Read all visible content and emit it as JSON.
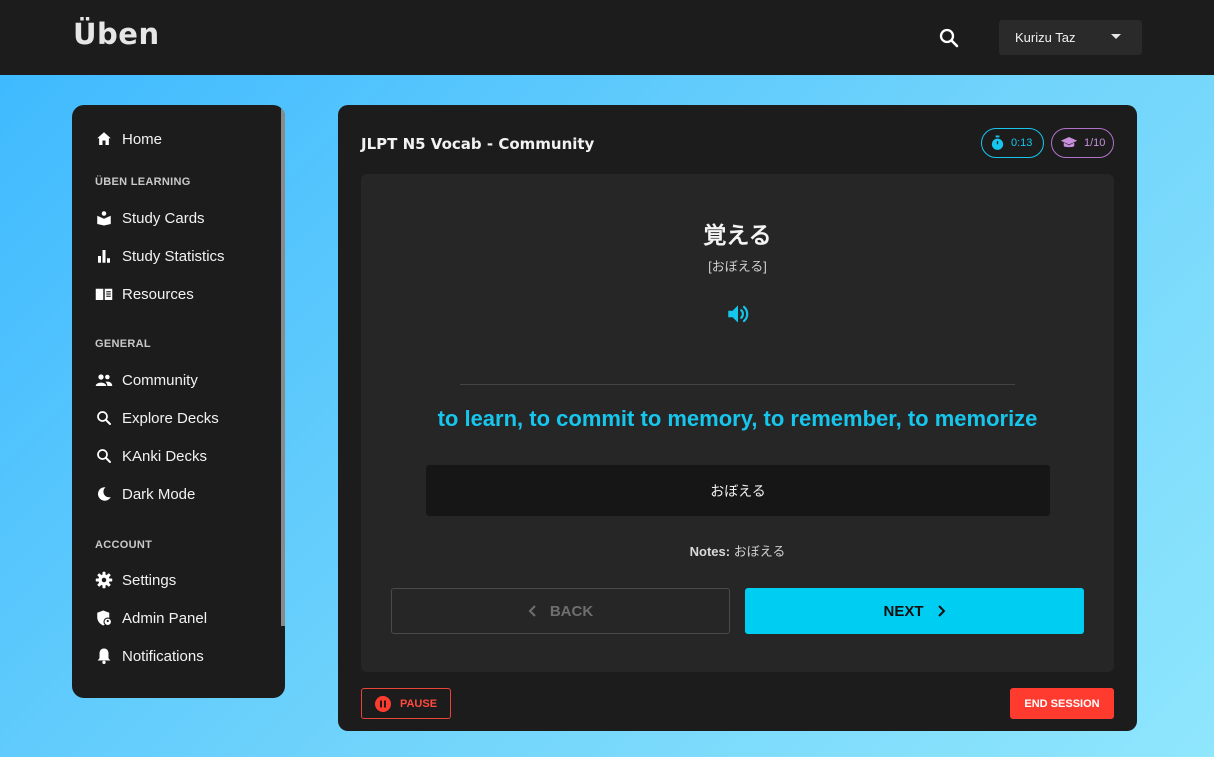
{
  "header": {
    "brand": "Üben",
    "search_icon": "search-icon",
    "user_name": "Kurizu Taz"
  },
  "sidebar": {
    "items_top": [
      {
        "label": "Home",
        "icon": "home-icon"
      }
    ],
    "sections": [
      {
        "heading": "ÜBEN LEARNING",
        "items": [
          {
            "label": "Study Cards",
            "icon": "book-open-icon"
          },
          {
            "label": "Study Statistics",
            "icon": "bar-chart-icon"
          },
          {
            "label": "Resources",
            "icon": "menu-book-icon"
          }
        ]
      },
      {
        "heading": "GENERAL",
        "items": [
          {
            "label": "Community",
            "icon": "people-icon"
          },
          {
            "label": "Explore Decks",
            "icon": "search-icon"
          },
          {
            "label": "KAnki Decks",
            "icon": "search-icon"
          },
          {
            "label": "Dark Mode",
            "icon": "moon-icon"
          }
        ]
      },
      {
        "heading": "ACCOUNT",
        "items": [
          {
            "label": "Settings",
            "icon": "gear-icon"
          },
          {
            "label": "Admin Panel",
            "icon": "admin-shield-icon"
          },
          {
            "label": "Notifications",
            "icon": "bell-icon"
          }
        ]
      }
    ]
  },
  "session": {
    "deck_title": "JLPT N5 Vocab - Community",
    "timer": "0:13",
    "progress": "1/10",
    "card": {
      "word": "覚える",
      "reading": "[おぼえる]",
      "meaning": "to learn, to commit to memory, to remember, to memorize",
      "answer_value": "おぼえる",
      "notes_label": "Notes:",
      "notes_value": "おぼえる"
    },
    "back_label": "BACK",
    "next_label": "NEXT",
    "pause_label": "PAUSE",
    "end_label": "END SESSION"
  },
  "colors": {
    "accent": "#00cdf2",
    "danger": "#ff3b30",
    "progress_pill": "#b173c9",
    "surface": "#1c1c1c"
  }
}
